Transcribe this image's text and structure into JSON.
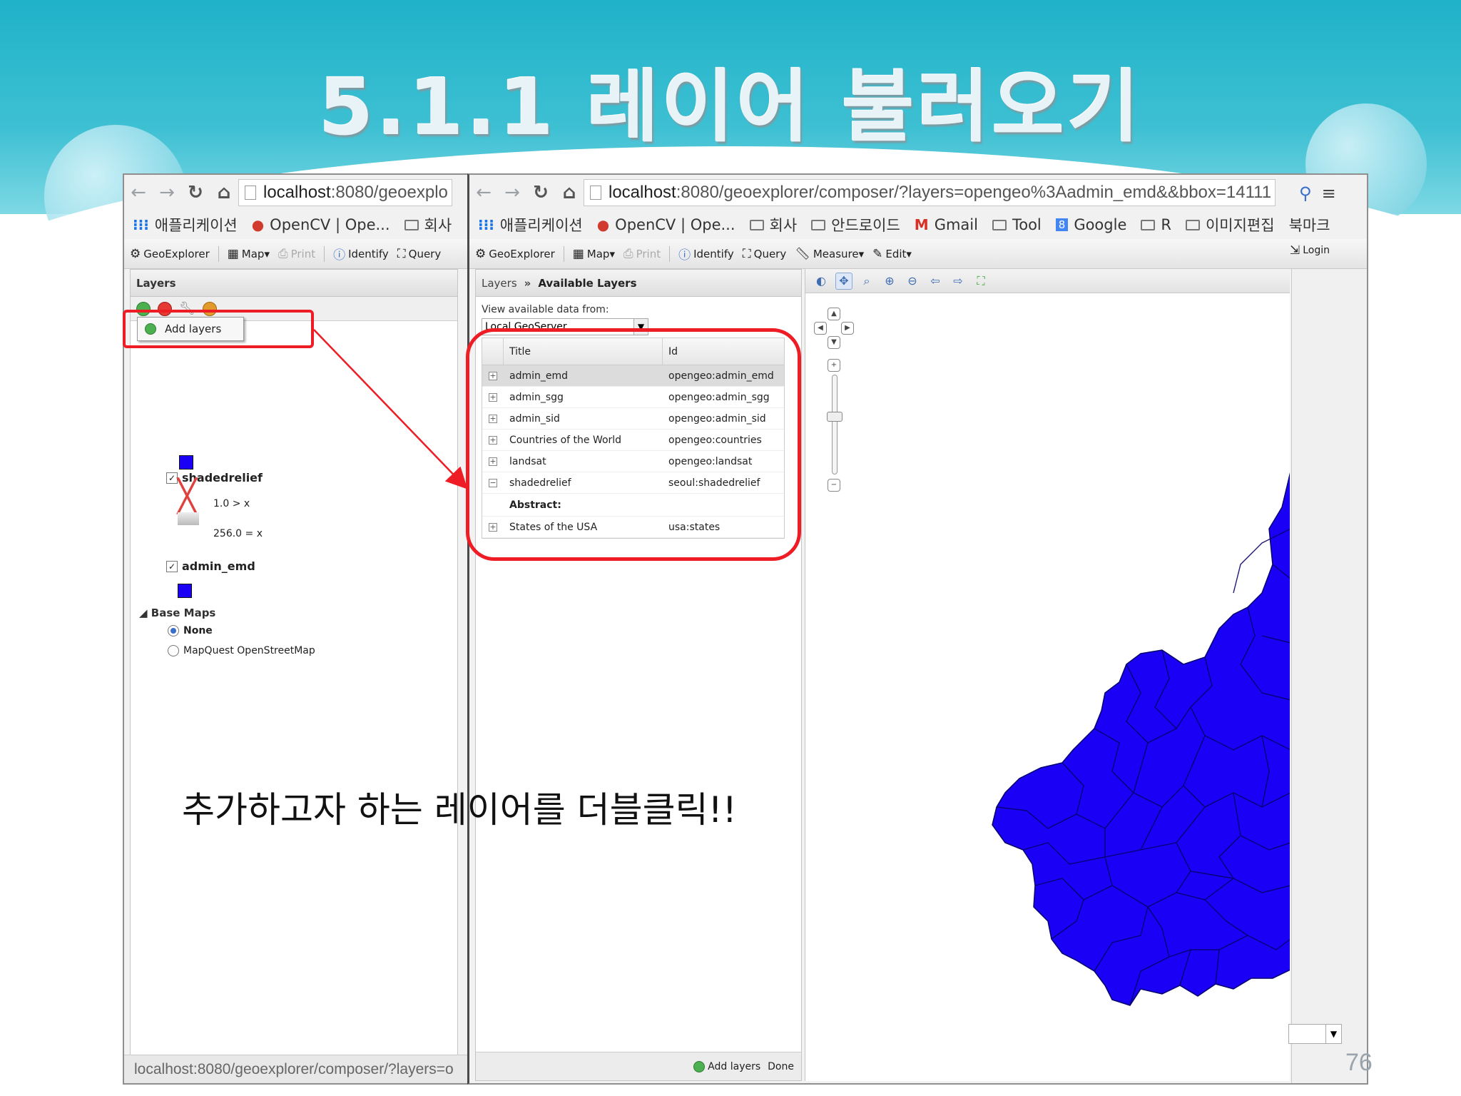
{
  "slide": {
    "title": "5.1.1 레이어 불러오기",
    "instruction": "추가하고자 하는 레이어를 더블클릭!!",
    "page_number": "76"
  },
  "left_window": {
    "url_host": "localhost",
    "url_rest": ":8080/geoexplo",
    "bookmarks": [
      {
        "icon": "apps-icon",
        "label": "애플리케이션"
      },
      {
        "icon": "opencv-icon",
        "label": "OpenCV | Ope..."
      },
      {
        "icon": "folder-icon",
        "label": "회사"
      }
    ],
    "toolbar": {
      "geoexplorer": "GeoExplorer",
      "map": "Map",
      "print": "Print",
      "identify": "Identify",
      "query": "Query"
    },
    "layers_panel": {
      "title": "Layers",
      "add_layers_menu": "Add layers",
      "layers": [
        {
          "name": "shadedrelief",
          "checked": true
        },
        {
          "name": "admin_emd",
          "checked": true
        }
      ],
      "legend_max": "1.0",
      "legend_max_op": ">",
      "legend_max_var": "x",
      "legend_min": "256.0",
      "legend_min_op": "=",
      "legend_min_var": "x",
      "base_maps_title": "Base Maps",
      "base_maps": [
        {
          "label": "None",
          "selected": true
        },
        {
          "label": "MapQuest OpenStreetMap",
          "selected": false
        }
      ]
    },
    "status_url": "localhost:8080/geoexplorer/composer/?layers=o"
  },
  "right_window": {
    "url_host": "localhost",
    "url_rest": ":8080/geoexplorer/composer/?layers=opengeo%3Aadmin_emd&&bbox=14111",
    "bookmarks": [
      {
        "icon": "apps-icon",
        "label": "애플리케이션"
      },
      {
        "icon": "opencv-icon",
        "label": "OpenCV | Ope..."
      },
      {
        "icon": "folder-icon",
        "label": "회사"
      },
      {
        "icon": "folder-icon",
        "label": "안드로이드"
      },
      {
        "icon": "gmail-icon",
        "label": "Gmail"
      },
      {
        "icon": "folder-icon",
        "label": "Tool"
      },
      {
        "icon": "google-icon",
        "label": "Google"
      },
      {
        "icon": "folder-icon",
        "label": "R"
      },
      {
        "icon": "folder-icon",
        "label": "이미지편집"
      }
    ],
    "bookmarks_overflow": "북마크",
    "toolbar": {
      "geoexplorer": "GeoExplorer",
      "map": "Map",
      "print": "Print",
      "identify": "Identify",
      "query": "Query",
      "measure": "Measure",
      "edit": "Edit",
      "login": "Login"
    },
    "available_layers": {
      "breadcrumb_root": "Layers",
      "breadcrumb_sep": "»",
      "breadcrumb_current": "Available Layers",
      "source_label": "View available data from:",
      "source_value": "Local GeoServer",
      "columns": {
        "title": "Title",
        "id": "Id"
      },
      "rows": [
        {
          "title": "admin_emd",
          "id": "opengeo:admin_emd",
          "selected": true,
          "expanded": false
        },
        {
          "title": "admin_sgg",
          "id": "opengeo:admin_sgg",
          "selected": false,
          "expanded": false
        },
        {
          "title": "admin_sid",
          "id": "opengeo:admin_sid",
          "selected": false,
          "expanded": false
        },
        {
          "title": "Countries of the World",
          "id": "opengeo:countries",
          "selected": false,
          "expanded": false
        },
        {
          "title": "landsat",
          "id": "opengeo:landsat",
          "selected": false,
          "expanded": false
        },
        {
          "title": "shadedrelief",
          "id": "seoul:shadedrelief",
          "selected": false,
          "expanded": true
        },
        {
          "title": "States of the USA",
          "id": "usa:states",
          "selected": false,
          "expanded": false
        }
      ],
      "abstract_label": "Abstract:",
      "add_layers_button": "Add layers",
      "done_button": "Done"
    },
    "map": {
      "fill_color": "#1a00f5"
    }
  }
}
